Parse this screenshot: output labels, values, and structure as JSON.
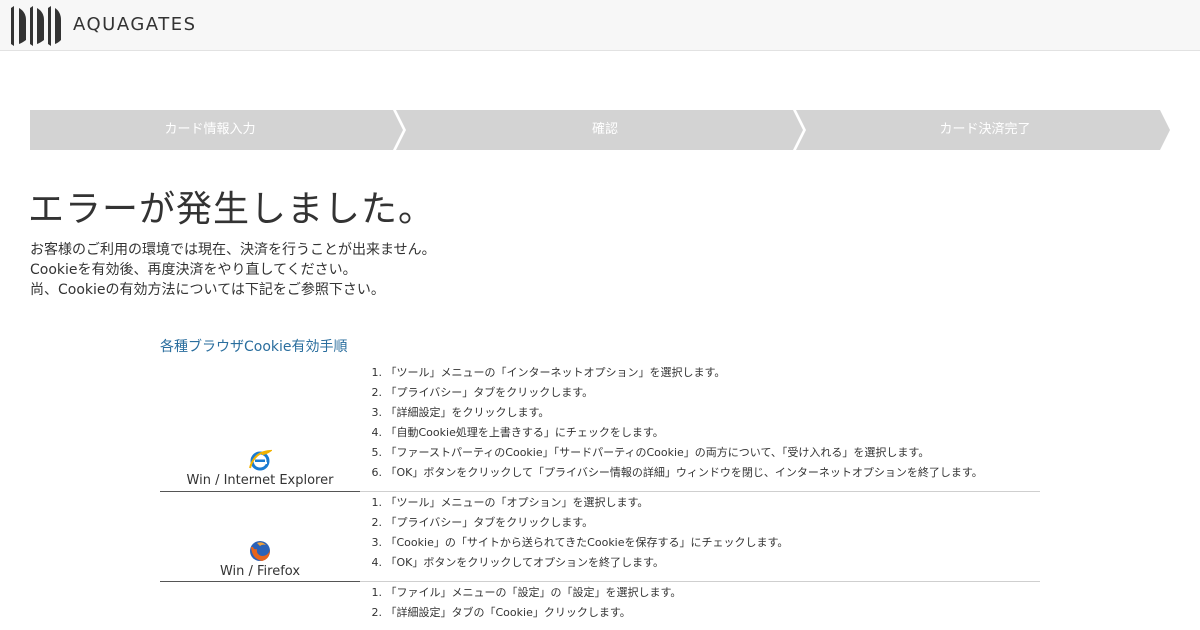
{
  "header": {
    "logo_text": "AQUAGATES",
    "logo_icon": "aquagates-logo-mark"
  },
  "progress": {
    "steps": [
      "カード情報入力",
      "確認",
      "カード決済完了"
    ],
    "colors": {
      "step_bg": "#d3d3d3",
      "step_text": "#ffffff"
    }
  },
  "error": {
    "title": "エラーが発生しました。",
    "lines": [
      "お客様のご利用の環境では現在、決済を行うことが出来ません。",
      "Cookieを有効後、再度決済をやり直してください。",
      "尚、Cookieの有効方法については下記をご参照下さい。"
    ]
  },
  "guide": {
    "title": "各種ブラウザCookie有効手順",
    "browsers": [
      {
        "name": "Win / Internet Explorer",
        "icon": "internet-explorer-icon",
        "steps": [
          "「ツール」メニューの「インターネットオプション」を選択します。",
          "「プライバシー」タブをクリックします。",
          "「詳細設定」をクリックします。",
          "「自動Cookie処理を上書きする」にチェックをします。",
          "「ファーストパーティのCookie」「サードパーティのCookie」の両方について、「受け入れる」を選択します。",
          "「OK」ボタンをクリックして「プライバシー情報の詳細」ウィンドウを閉じ、インターネットオプションを終了します。"
        ]
      },
      {
        "name": "Win / Firefox",
        "icon": "firefox-icon",
        "steps": [
          "「ツール」メニューの「オプション」を選択します。",
          "「プライバシー」タブをクリックします。",
          "「Cookie」の「サイトから送られてきたCookieを保存する」にチェックします。",
          "「OK」ボタンをクリックしてオプションを終了します。"
        ]
      },
      {
        "name": "",
        "icon": "",
        "steps": [
          "「ファイル」メニューの「設定」の「設定」を選択します。",
          "「詳細設定」タブの「Cookie」クリックします。",
          ""
        ]
      }
    ]
  },
  "colors": {
    "header_bg": "#f7f7f7",
    "link_blue": "#2a6e9e",
    "text": "#333333"
  }
}
